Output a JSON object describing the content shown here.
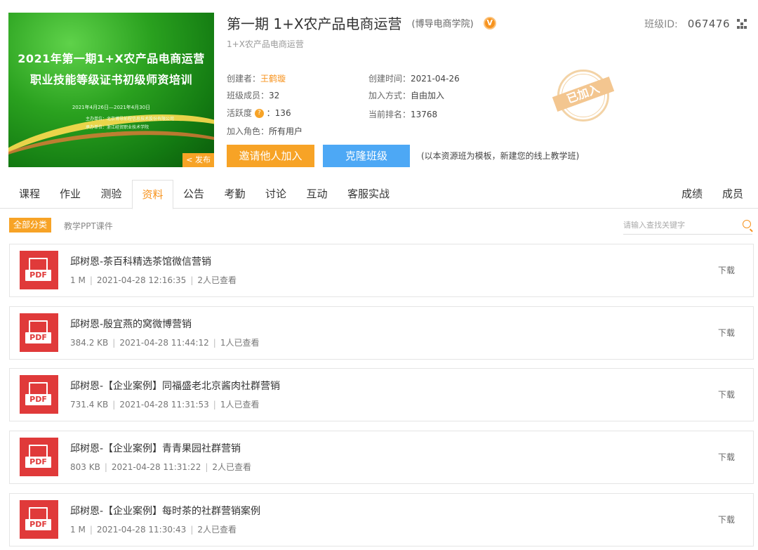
{
  "banner": {
    "line1": "2021年第一期1+X农产品电商运营",
    "line2": "职业技能等级证书初级师资培训",
    "dates": "2021年4月26日—2021年4月30日",
    "host": "主办单位：北京博导前程信息技术股份有限公司",
    "co_host": "承办单位：浙江经贸职业技术学院",
    "publish_label": "发布"
  },
  "header": {
    "title": "第一期 1+X农产品电商运营",
    "org": "(博导电商学院)",
    "badge": "V",
    "subtitle": "1+X农产品电商运营",
    "class_id_label": "班级ID:",
    "class_id_value": "067476"
  },
  "info": {
    "creator_label": "创建者：",
    "creator_value": "王鹤璇",
    "created_label": "创建时间：",
    "created_value": "2021-04-26",
    "members_label": "班级成员：",
    "members_value": "32",
    "join_mode_label": "加入方式：",
    "join_mode_value": "自由加入",
    "activity_label": "活跃度",
    "activity_value": "：136",
    "rank_label": "当前排名：",
    "rank_value": "13768",
    "role_label": "加入角色：",
    "role_value": "所有用户",
    "joined_stamp": "已加入"
  },
  "actions": {
    "invite_label": "邀请他人加入",
    "clone_label": "克隆班级",
    "clone_note": "(以本资源班为模板，新建您的线上教学班)"
  },
  "tabs": {
    "course": "课程",
    "homework": "作业",
    "quiz": "测验",
    "materials": "资料",
    "notice": "公告",
    "attendance": "考勤",
    "discussion": "讨论",
    "interaction": "互动",
    "practice": "客服实战",
    "grades": "成绩",
    "members": "成员"
  },
  "filter": {
    "all_label": "全部分类",
    "ppt_label": "教学PPT课件",
    "search_placeholder": "请输入查找关键字"
  },
  "files": [
    {
      "name": "邱树恩-茶百科精选茶馆微信营销",
      "size": "1 M",
      "time": "2021-04-28 12:16:35",
      "views": "2人已查看",
      "icon_label": "PDF",
      "download": "下载"
    },
    {
      "name": "邱树恩-殷宜燕的窝微博营销",
      "size": "384.2 KB",
      "time": "2021-04-28 11:44:12",
      "views": "1人已查看",
      "icon_label": "PDF",
      "download": "下载"
    },
    {
      "name": "邱树恩-【企业案例】同福盛老北京酱肉社群营销",
      "size": "731.4 KB",
      "time": "2021-04-28 11:31:53",
      "views": "1人已查看",
      "icon_label": "PDF",
      "download": "下载"
    },
    {
      "name": "邱树恩-【企业案例】青青果园社群营销",
      "size": "803 KB",
      "time": "2021-04-28 11:31:22",
      "views": "2人已查看",
      "icon_label": "PDF",
      "download": "下载"
    },
    {
      "name": "邱树恩-【企业案例】每时茶的社群营销案例",
      "size": "1 M",
      "time": "2021-04-28 11:30:43",
      "views": "2人已查看",
      "icon_label": "PDF",
      "download": "下载"
    }
  ],
  "meta_separator": "|",
  "colors": {
    "accent": "#f7a326",
    "blue": "#4da8f5",
    "pdf_red": "#e03a3a"
  }
}
